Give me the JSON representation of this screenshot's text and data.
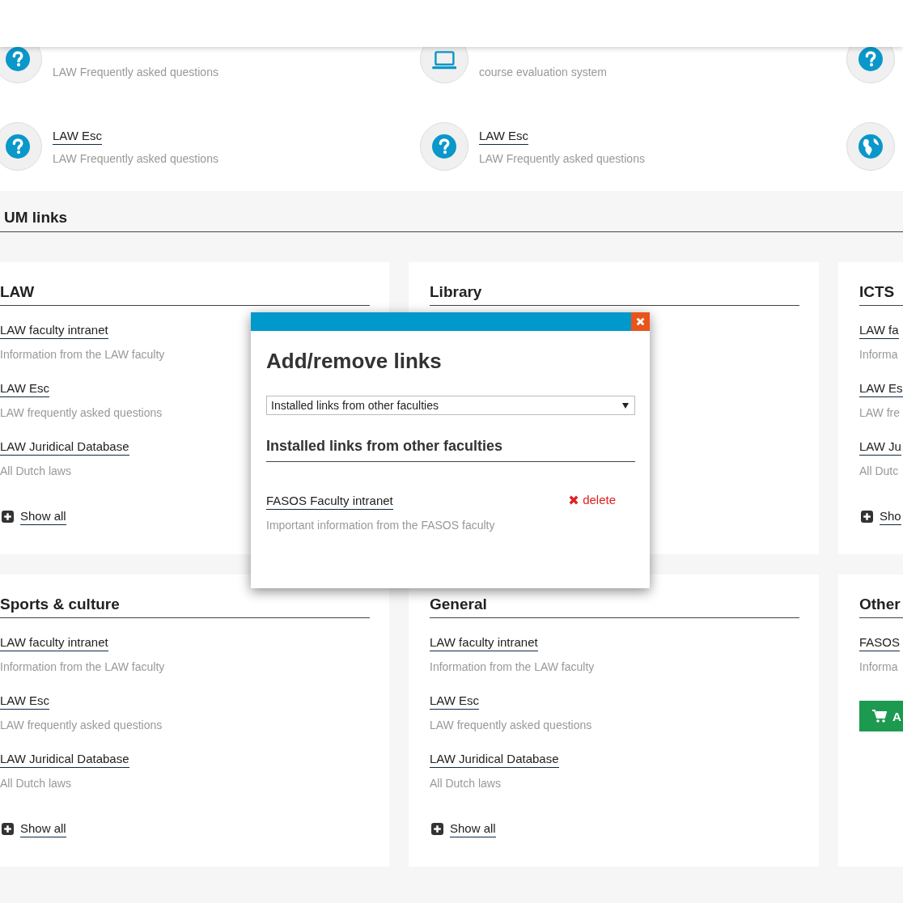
{
  "tiles": [
    {
      "kind": "question",
      "description": "LAW Frequently asked questions"
    },
    {
      "kind": "laptop",
      "description": "course evaluation system"
    },
    {
      "kind": "question"
    },
    {
      "kind": "question",
      "title": "LAW Esc",
      "description": "LAW Frequently asked questions"
    },
    {
      "kind": "question",
      "title": "LAW Esc",
      "description": "LAW Frequently asked questions"
    },
    {
      "kind": "globe"
    }
  ],
  "section_title": "UM links",
  "cards": [
    {
      "title": "LAW",
      "links": [
        {
          "title": "LAW faculty intranet",
          "description": "Information from the LAW faculty"
        },
        {
          "title": "LAW Esc",
          "description": "LAW frequently asked questions"
        },
        {
          "title": "LAW Juridical Database",
          "description": "All Dutch laws"
        }
      ],
      "show_all": "Show all"
    },
    {
      "title": "Library"
    },
    {
      "title": "ICTS",
      "links": [
        {
          "title": "LAW fa",
          "description": "Informa"
        },
        {
          "title": "LAW Es",
          "description": "LAW fre"
        },
        {
          "title": "LAW Ju",
          "description": "All Dutc"
        }
      ],
      "show_all": "Sho"
    },
    {
      "title": "Sports & culture",
      "links": [
        {
          "title": "LAW faculty intranet",
          "description": "Information from the LAW faculty"
        },
        {
          "title": "LAW Esc",
          "description": "LAW frequently asked questions"
        },
        {
          "title": "LAW Juridical Database",
          "description": "All Dutch laws"
        }
      ],
      "show_all": "Show all"
    },
    {
      "title": "General",
      "links": [
        {
          "title": "LAW faculty intranet",
          "description": "Information from the LAW faculty"
        },
        {
          "title": "LAW Esc",
          "description": "LAW frequently asked questions"
        },
        {
          "title": "LAW Juridical Database",
          "description": "All Dutch laws"
        }
      ],
      "show_all": "Show all"
    },
    {
      "title": "Other",
      "links": [
        {
          "title": "FASOS",
          "description": "Informa"
        }
      ],
      "button": "A"
    }
  ],
  "modal": {
    "title": "Add/remove links",
    "select": {
      "value": "Installed links from other faculties"
    },
    "heading": "Installed links from other faculties",
    "links": [
      {
        "title": "FASOS Faculty intranet",
        "description": "Important information from the FASOS faculty",
        "action": "delete"
      }
    ]
  }
}
